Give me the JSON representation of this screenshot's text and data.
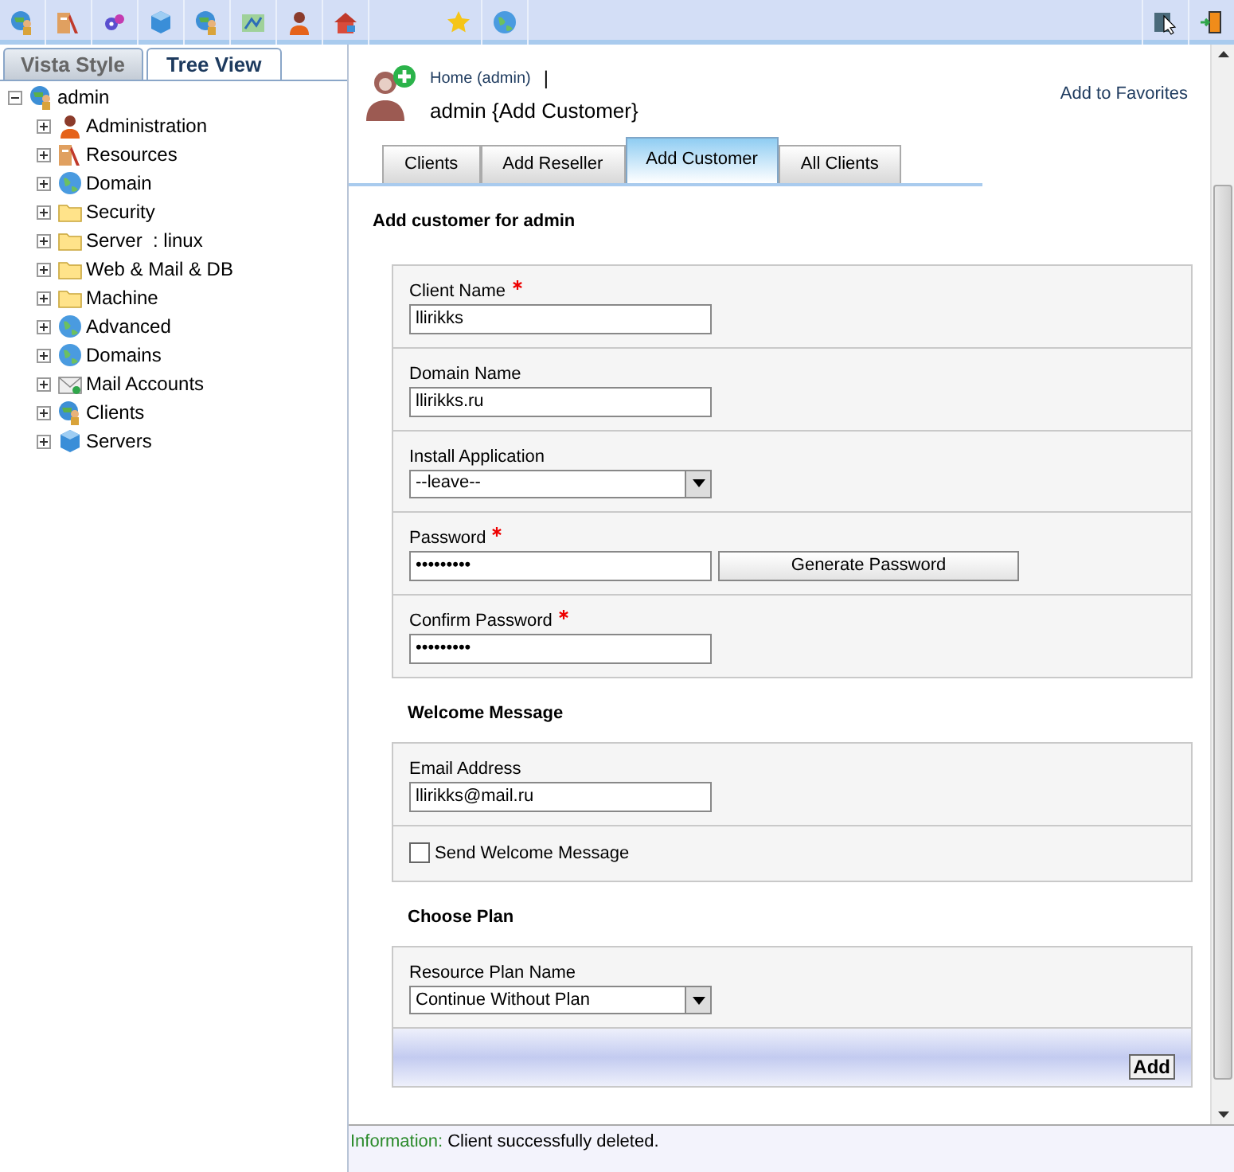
{
  "toolbar": {
    "left_buttons": [
      {
        "kind": "globe-person"
      },
      {
        "kind": "tools"
      },
      {
        "kind": "gears"
      },
      {
        "kind": "cube"
      },
      {
        "kind": "globe-person"
      },
      {
        "kind": "map"
      },
      {
        "kind": "person"
      },
      {
        "kind": "house"
      },
      {
        "kind": "gap"
      },
      {
        "kind": "star"
      },
      {
        "kind": "globe"
      }
    ],
    "right_buttons": [
      {
        "kind": "cursor"
      },
      {
        "kind": "door"
      }
    ]
  },
  "left_tabs": [
    {
      "label": "Vista Style",
      "selected": false
    },
    {
      "label": "Tree View",
      "selected": true
    }
  ],
  "tree": {
    "label": "admin",
    "kind": "globe-person",
    "expanded": true,
    "children": [
      {
        "label": "Administration",
        "kind": "person",
        "expanded": false
      },
      {
        "label": "Resources",
        "kind": "tools",
        "expanded": false
      },
      {
        "label": "Domain",
        "kind": "globe",
        "expanded": false
      },
      {
        "label": "Security",
        "kind": "folder",
        "expanded": false
      },
      {
        "label": "Server  : linux",
        "kind": "folder",
        "expanded": false
      },
      {
        "label": "Web & Mail & DB",
        "kind": "folder",
        "expanded": false
      },
      {
        "label": "Machine",
        "kind": "folder",
        "expanded": false
      },
      {
        "label": "Advanced",
        "kind": "globe",
        "expanded": false
      },
      {
        "label": "Domains",
        "kind": "globe",
        "expanded": false
      },
      {
        "label": "Mail Accounts",
        "kind": "mail",
        "expanded": false
      },
      {
        "label": "Clients",
        "kind": "globe-person",
        "expanded": false
      },
      {
        "label": "Servers",
        "kind": "cube",
        "expanded": false
      }
    ]
  },
  "header": {
    "breadcrumb": "Home (admin)",
    "separator": "|",
    "title": "admin {Add Customer}",
    "favorites": "Add to Favorites"
  },
  "tabs": [
    {
      "label": "Clients",
      "selected": false
    },
    {
      "label": "Add Reseller",
      "selected": false
    },
    {
      "label": "Add Customer",
      "selected": true
    },
    {
      "label": "All Clients",
      "selected": false
    }
  ],
  "section_title": "Add customer for admin",
  "groups": [
    {
      "rows": [
        {
          "kind": "text",
          "label": "Client Name",
          "required": true,
          "value": "llirikks"
        },
        {
          "kind": "text",
          "label": "Domain Name",
          "required": false,
          "value": "llirikks.ru"
        },
        {
          "kind": "select",
          "label": "Install Application",
          "required": false,
          "value": "--leave--"
        },
        {
          "kind": "password",
          "label": "Password",
          "required": true,
          "value": "•••••••••",
          "button": "Generate Password"
        },
        {
          "kind": "password",
          "label": "Confirm Password",
          "required": true,
          "value": "•••••••••"
        }
      ]
    },
    {
      "title": "Welcome Message",
      "rows": [
        {
          "kind": "text",
          "label": "Email Address",
          "required": false,
          "value": "llirikks@mail.ru"
        },
        {
          "kind": "checkbox",
          "label": "Send Welcome Message",
          "checked": false
        }
      ]
    },
    {
      "title": "Choose Plan",
      "rows": [
        {
          "kind": "select",
          "label": "Resource Plan Name",
          "required": false,
          "value": "Continue Without Plan"
        }
      ],
      "button": "Add"
    }
  ],
  "status": {
    "label": "Information:",
    "text": "Client successfully deleted."
  }
}
